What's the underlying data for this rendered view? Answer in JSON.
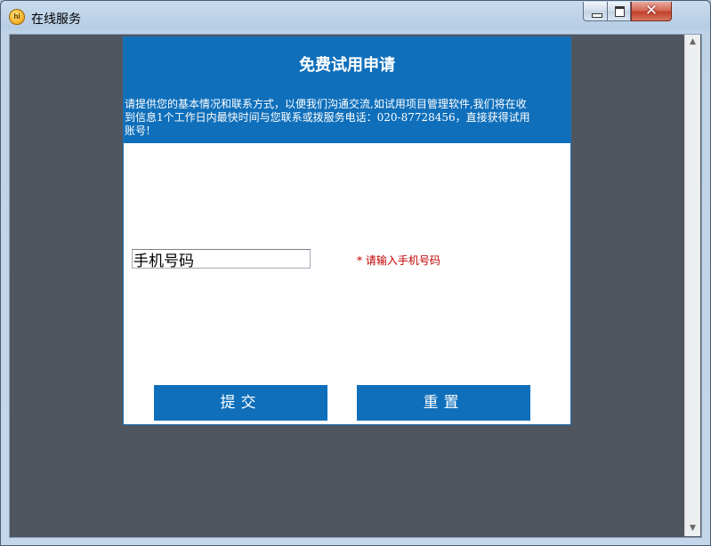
{
  "window": {
    "title": "在线服务",
    "icon": "hi-chat-app-icon",
    "icon_glyph": "hi",
    "controls": {
      "minimize": "minimize-icon",
      "maximize": "maximize-icon",
      "close": "close-icon",
      "close_glyph": "✕"
    }
  },
  "scrollbar": {
    "up_glyph": "▲",
    "down_glyph": "▼"
  },
  "form": {
    "title": "免费试用申请",
    "intro": "请提供您的基本情况和联系方式，以便我们沟通交流,如试用项目管理软件,我们将在收到信息1个工作日内最快时间与您联系或拨服务电话：020-87728456，直接获得试用账号!",
    "phone_field": {
      "value": "手机号码",
      "placeholder": "手机号码"
    },
    "phone_hint": "* 请输入手机号码",
    "submit_label": "提交",
    "reset_label": "重置"
  },
  "colors": {
    "accent": "#0f6fbb",
    "client_bg": "#4f5660",
    "hint": "#c00000"
  }
}
